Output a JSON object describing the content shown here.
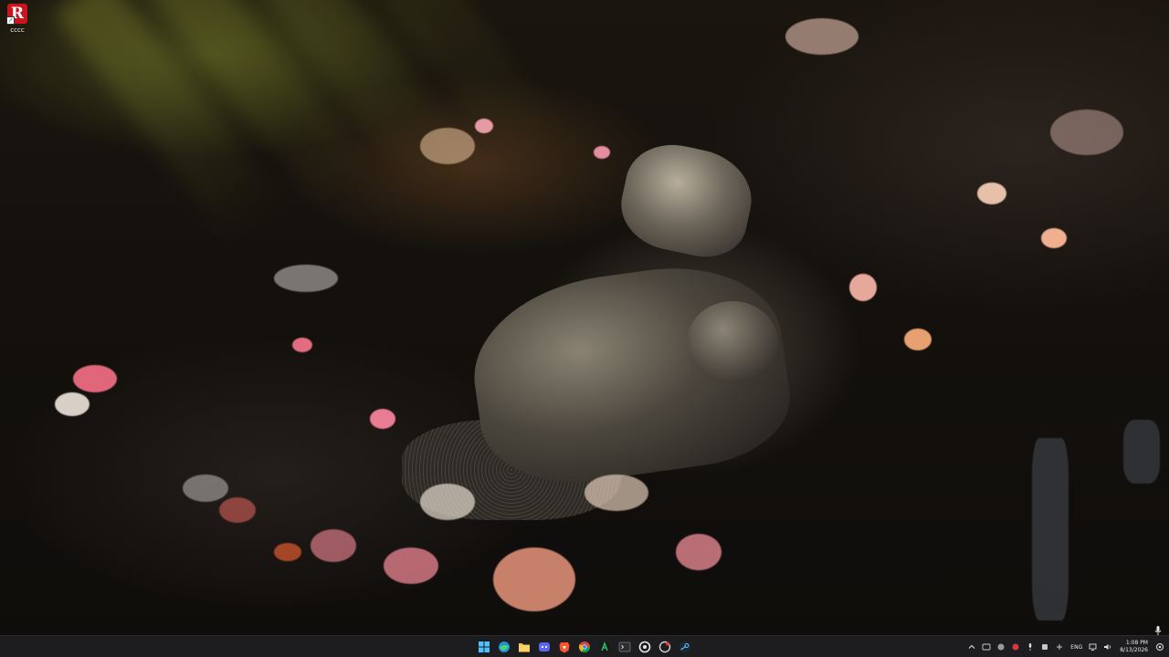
{
  "desktop": {
    "icons": [
      {
        "label": "cccc",
        "glyph": "R",
        "icon": "red-r-app-icon",
        "color": "#c9151e"
      }
    ]
  },
  "taskbar": {
    "pinned": [
      {
        "name": "start-button",
        "icon": "windows-logo-icon"
      },
      {
        "name": "edge-button",
        "icon": "edge-icon"
      },
      {
        "name": "file-explorer-button",
        "icon": "folder-icon"
      },
      {
        "name": "discord-button",
        "icon": "discord-icon"
      },
      {
        "name": "brave-button",
        "icon": "brave-icon"
      },
      {
        "name": "chrome-button",
        "icon": "chrome-icon"
      },
      {
        "name": "text-app-button",
        "icon": "a-letter-icon"
      },
      {
        "name": "terminal-button",
        "icon": "terminal-icon"
      },
      {
        "name": "circular-app-button",
        "icon": "circle-app-icon"
      },
      {
        "name": "recorder-app-button",
        "icon": "recorder-icon"
      },
      {
        "name": "steam-button",
        "icon": "steam-icon"
      }
    ],
    "tray": {
      "language": "ENG",
      "time": "1:08 PM",
      "date": "8/13/2026"
    }
  },
  "colors": {
    "taskbar_bg": "#1d1d1f",
    "accent": "#4cc2ff"
  }
}
